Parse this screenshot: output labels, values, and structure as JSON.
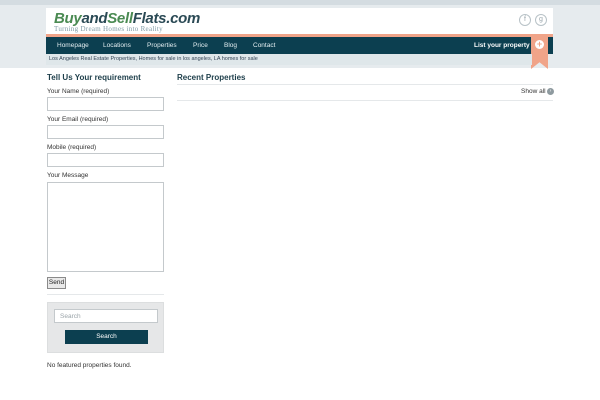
{
  "header": {
    "logo": {
      "part1": "Buy",
      "part2": "and",
      "part3": "Sell",
      "part4": "Flats.com"
    },
    "tagline": "Turning Dream Homes into Reality",
    "social_icons": [
      "facebook-icon",
      "googleplus-icon"
    ]
  },
  "nav": {
    "items": [
      "Homepage",
      "Locations",
      "Properties",
      "Price",
      "Blog",
      "Contact"
    ],
    "cta": "List your property",
    "cta_icon": "plus-icon"
  },
  "breadcrumb": "Los Angeles Real Estate Properties, Homes for sale in los angeles, LA homes for sale",
  "sidebar": {
    "title": "Tell Us Your requirement",
    "name_label": "Your Name (required)",
    "email_label": "Your Email (required)",
    "mobile_label": "Mobile (required)",
    "message_label": "Your Message",
    "send_label": "Send",
    "search_placeholder": "Search",
    "search_button": "Search",
    "no_featured": "No featured properties found."
  },
  "main": {
    "title": "Recent Properties",
    "show_all": "Show all"
  },
  "colors": {
    "nav_bg": "#0c3f50",
    "accent": "#f0a489",
    "logo_green": "#4a8a52",
    "logo_dark": "#2b4a55",
    "band_bg": "#e6ebee"
  }
}
